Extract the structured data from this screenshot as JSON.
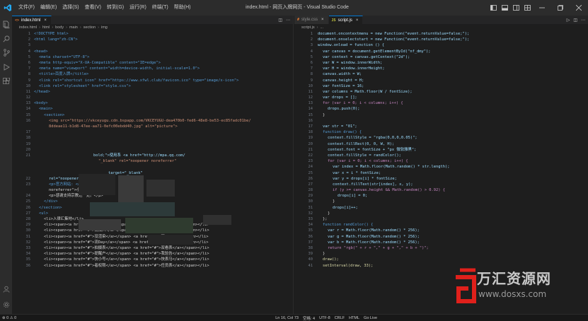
{
  "window": {
    "title": "index.html - 网页入牌网页 - Visual Studio Code",
    "menu": [
      "文件(F)",
      "编辑(E)",
      "选择(S)",
      "查看(V)",
      "转到(G)",
      "运行(R)",
      "终端(T)",
      "帮助(H)"
    ]
  },
  "left_editor": {
    "tabs": [
      {
        "label": "index.html",
        "icon": "<>",
        "active": true
      }
    ],
    "breadcrumb": [
      "index.html",
      "html",
      "body",
      "main",
      "section",
      "img"
    ],
    "lines": [
      {
        "n": "1",
        "text": "<!DOCTYPE html>",
        "indent": 1,
        "color": "#569cd6"
      },
      {
        "n": "2",
        "text": "<html lang=\"zh-CN\">",
        "indent": 1,
        "color": "#569cd6"
      },
      {
        "n": "3",
        "text": "",
        "indent": 0,
        "color": "#d4d4d4"
      },
      {
        "n": "4",
        "text": "<head>",
        "indent": 1,
        "color": "#569cd6"
      },
      {
        "n": "5",
        "text": "<meta charset=\"UTF-8\">",
        "indent": 2,
        "color": "#569cd6"
      },
      {
        "n": "6",
        "text": "<meta http-equiv=\"X-UA-Compatible\" content=\"IE=edge\">",
        "indent": 2,
        "color": "#569cd6"
      },
      {
        "n": "7",
        "text": "<meta name=\"viewport\" content=\"width=device-width, initial-scale=1.0\">",
        "indent": 2,
        "color": "#569cd6"
      },
      {
        "n": "8",
        "text": "<title>百度入牌</title>",
        "indent": 2,
        "color": "#569cd6"
      },
      {
        "n": "9",
        "text": "<link rel=\"shortcut icon\" href=\"https://www.xfwl.club/favicon.ico\" type=\"image/x-icon\">",
        "indent": 2,
        "color": "#569cd6"
      },
      {
        "n": "10",
        "text": "<link rel=\"stylesheet\" href=\"style.css\">",
        "indent": 2,
        "color": "#569cd6"
      },
      {
        "n": "11",
        "text": "</head>",
        "indent": 1,
        "color": "#569cd6"
      },
      {
        "n": "12",
        "text": "",
        "indent": 0,
        "color": "#d4d4d4"
      },
      {
        "n": "13",
        "text": "<body>",
        "indent": 1,
        "color": "#569cd6"
      },
      {
        "n": "14",
        "text": "<main>",
        "indent": 2,
        "color": "#569cd6"
      },
      {
        "n": "15",
        "text": "<section>",
        "indent": 3,
        "color": "#569cd6"
      },
      {
        "n": "16",
        "text": "<img src=\"https://vkceyugu.cdn.bspapp.com/VKCEYUGU-dea470b0-fed6-48e8-be53-ec85fadc01be/",
        "indent": 4,
        "color": "#ce9178"
      },
      {
        "n": "",
        "text": "8ddeae11-b1d8-47ee-aa71-0efc00ebdd40.jpg\" alt=\"picture\">",
        "indent": 4,
        "color": "#ce9178"
      },
      {
        "n": "17",
        "text": "",
        "indent": 0,
        "color": "#d4d4d4"
      },
      {
        "n": "18",
        "text": "",
        "indent": 0,
        "color": "#d4d4d4"
      },
      {
        "n": "19",
        "text": "",
        "indent": 0,
        "color": "#d4d4d4"
      },
      {
        "n": "20",
        "text": "",
        "indent": 0,
        "color": "#d4d4d4"
      },
      {
        "n": "21",
        "text": "bold;\">使用系 <a href=\"http://mpa.qq.com/",
        "indent": 13,
        "color": "#9cdcfe"
      },
      {
        "n": "",
        "text": "\"_blank\" rel=\"noopener noreferrer\"",
        "indent": 14,
        "color": "#ce9178"
      },
      {
        "n": "",
        "text": "",
        "indent": 0,
        "color": "#d4d4d4"
      },
      {
        "n": "",
        "text": "target=\"_blank\"",
        "indent": 16,
        "color": "#9cdcfe"
      },
      {
        "n": "22",
        "text": "rel=\"noopener norefer",
        "indent": 4,
        "color": "#9cdcfe"
      },
      {
        "n": "23",
        "text": "<p>官方网站: <a href=\"ht",
        "indent": 4,
        "color": "#569cd6"
      },
      {
        "n": "",
        "text": "noreferrer\">小枫网络</a></p>",
        "indent": 4,
        "color": "#d4d4d4"
      },
      {
        "n": "24",
        "text": "<p>感谢支持宗教进一处。</p>",
        "indent": 4,
        "color": "#d4d4d4"
      },
      {
        "n": "25",
        "text": "</div>",
        "indent": 3,
        "color": "#569cd6"
      },
      {
        "n": "26",
        "text": "</section>",
        "indent": 2,
        "color": "#569cd6"
      },
      {
        "n": "27",
        "text": "<ul>",
        "indent": 2,
        "color": "#569cd6"
      },
      {
        "n": "28",
        "text": "<li>入律汇集地</li>",
        "indent": 3,
        "color": "#d4d4d4"
      },
      {
        "n": "29",
        "text": "<li><span><a href=\"#\">迷你版</a></span> <a href=\"#\">我法入</a></span></li>",
        "indent": 3,
        "color": "#d4d4d4"
      },
      {
        "n": "30",
        "text": "<li><span><a href=\"#\">流法入</a></span> <a href=\"#\">联度法</a></span></li>",
        "indent": 3,
        "color": "#d4d4d4"
      },
      {
        "n": "31",
        "text": "<li><span><a href=\"#\">没渲染</a></span> <a href=\"#\">双Day</a></span></li>",
        "indent": 3,
        "color": "#d4d4d4"
      },
      {
        "n": "32",
        "text": "<li><span><a href=\"#\">流Day</a></span> <a href=\"#\">拼音表</a></span></li>",
        "indent": 3,
        "color": "#d4d4d4"
      },
      {
        "n": "33",
        "text": "<li><span><a href=\"#\">拍摄表</a></span> <a href=\"#\">双看表</a></span></li>",
        "indent": 3,
        "color": "#d4d4d4"
      },
      {
        "n": "34",
        "text": "<li><span><a href=\"#\">提醒户</a></span> <a href=\"#\">我验告</a></span></li>",
        "indent": 3,
        "color": "#d4d4d4"
      },
      {
        "n": "35",
        "text": "<li><span><a href=\"#\">快小号</a></span> <a href=\"#\">快表马</a></span></li>",
        "indent": 3,
        "color": "#d4d4d4"
      },
      {
        "n": "36",
        "text": "<li><span><a href=\"#\">者权限</a></span> <a href=\"#\">任员表</a></span></li>",
        "indent": 3,
        "color": "#d4d4d4"
      }
    ]
  },
  "right_editor": {
    "tabs": [
      {
        "label": "style.css",
        "icon": "#",
        "active": false
      },
      {
        "label": "script.js",
        "icon": "JS",
        "active": true
      }
    ],
    "breadcrumb": [
      "script.js",
      "..."
    ],
    "lines": [
      {
        "n": "1",
        "text": "document.oncontextmenu = new Function(\"event.returnValue=false;\");",
        "indent": 1,
        "color": "#9cdcfe"
      },
      {
        "n": "2",
        "text": "document.onselectstart = new Function(\"event.returnValue=false;\");",
        "indent": 1,
        "color": "#9cdcfe"
      },
      {
        "n": "3",
        "text": "window.onload = function () {",
        "indent": 1,
        "color": "#9cdcfe"
      },
      {
        "n": "4",
        "text": "var canvas = document.getElementById(\"nf_dmy\");",
        "indent": 2,
        "color": "#9cdcfe"
      },
      {
        "n": "5",
        "text": "var context = canvas.getContext(\"2d\");",
        "indent": 2,
        "color": "#9cdcfe"
      },
      {
        "n": "6",
        "text": "var W = window.innerWidth;",
        "indent": 2,
        "color": "#9cdcfe"
      },
      {
        "n": "7",
        "text": "var H = window.innerHeight;",
        "indent": 2,
        "color": "#9cdcfe"
      },
      {
        "n": "8",
        "text": "canvas.width = W;",
        "indent": 2,
        "color": "#9cdcfe"
      },
      {
        "n": "9",
        "text": "canvas.height = H;",
        "indent": 2,
        "color": "#9cdcfe"
      },
      {
        "n": "10",
        "text": "var fontSize = 16;",
        "indent": 2,
        "color": "#9cdcfe"
      },
      {
        "n": "11",
        "text": "var columns = Math.floor(W / fontSize);",
        "indent": 2,
        "color": "#9cdcfe"
      },
      {
        "n": "12",
        "text": "var drops = [];",
        "indent": 2,
        "color": "#9cdcfe"
      },
      {
        "n": "13",
        "text": "for (var i = 0; i < columns; i++) {",
        "indent": 2,
        "color": "#c586c0"
      },
      {
        "n": "14",
        "text": "drops.push(0);",
        "indent": 3,
        "color": "#9cdcfe"
      },
      {
        "n": "15",
        "text": "}",
        "indent": 2,
        "color": "#d4d4d4"
      },
      {
        "n": "16",
        "text": "",
        "indent": 0,
        "color": "#d4d4d4"
      },
      {
        "n": "17",
        "text": "var str = \"01\";",
        "indent": 2,
        "color": "#9cdcfe"
      },
      {
        "n": "18",
        "text": "function draw() {",
        "indent": 2,
        "color": "#569cd6"
      },
      {
        "n": "19",
        "text": "context.fillStyle = \"rgba(0,0,0,0.05)\";",
        "indent": 3,
        "color": "#9cdcfe"
      },
      {
        "n": "20",
        "text": "context.fillRect(0, 0, W, H);",
        "indent": 3,
        "color": "#9cdcfe"
      },
      {
        "n": "21",
        "text": "context.font = fontSize + \"px 微软雅黑\";",
        "indent": 3,
        "color": "#9cdcfe"
      },
      {
        "n": "22",
        "text": "context.fillStyle = randColor();",
        "indent": 3,
        "color": "#9cdcfe"
      },
      {
        "n": "23",
        "text": "for (var i = 0; i < columns; i++) {",
        "indent": 3,
        "color": "#c586c0"
      },
      {
        "n": "24",
        "text": "var index = Math.floor(Math.random() * str.length);",
        "indent": 4,
        "color": "#9cdcfe"
      },
      {
        "n": "25",
        "text": "var x = i * fontSize;",
        "indent": 4,
        "color": "#9cdcfe"
      },
      {
        "n": "26",
        "text": "var y = drops[i] * fontSize;",
        "indent": 4,
        "color": "#9cdcfe"
      },
      {
        "n": "27",
        "text": "context.fillText(str[index], x, y);",
        "indent": 4,
        "color": "#9cdcfe"
      },
      {
        "n": "28",
        "text": "if (y >= canvas.height && Math.random() > 0.92) {",
        "indent": 4,
        "color": "#c586c0"
      },
      {
        "n": "29",
        "text": "drops[i] = 0;",
        "indent": 5,
        "color": "#9cdcfe"
      },
      {
        "n": "30",
        "text": "}",
        "indent": 4,
        "color": "#d4d4d4"
      },
      {
        "n": "31",
        "text": "drops[i]++;",
        "indent": 4,
        "color": "#9cdcfe"
      },
      {
        "n": "32",
        "text": "}",
        "indent": 3,
        "color": "#d4d4d4"
      },
      {
        "n": "33",
        "text": "};",
        "indent": 2,
        "color": "#d4d4d4"
      },
      {
        "n": "34",
        "text": "function randColor() {",
        "indent": 2,
        "color": "#569cd6"
      },
      {
        "n": "35",
        "text": "var r = Math.floor(Math.random() * 256);",
        "indent": 3,
        "color": "#9cdcfe"
      },
      {
        "n": "36",
        "text": "var g = Math.floor(Math.random() * 256);",
        "indent": 3,
        "color": "#9cdcfe"
      },
      {
        "n": "37",
        "text": "var b = Math.floor(Math.random() * 256);",
        "indent": 3,
        "color": "#9cdcfe"
      },
      {
        "n": "38",
        "text": "return \"rgb(\" + r + \",\" + g + \",\" + b + \")\";",
        "indent": 3,
        "color": "#c586c0"
      },
      {
        "n": "39",
        "text": "}",
        "indent": 2,
        "color": "#d4d4d4"
      },
      {
        "n": "40",
        "text": "draw();",
        "indent": 2,
        "color": "#dcdcaa"
      },
      {
        "n": "41",
        "text": "setInterval(draw, 33);",
        "indent": 2,
        "color": "#dcdcaa"
      }
    ]
  },
  "statusbar": {
    "items": [
      "⊗ 0 ⚠ 0",
      "Ln 16, Col 73",
      "空格: 4",
      "UTF-8",
      "CRLF",
      "HTML",
      "Go Live"
    ]
  },
  "watermark": {
    "text": "万汇资源网",
    "url": "www.dosxs.com"
  },
  "colors": {
    "accent": "#0078d4",
    "editor_bg": "#1e1e1e",
    "chrome_bg": "#2c2c2c",
    "watermark_red": "#e0201b"
  }
}
